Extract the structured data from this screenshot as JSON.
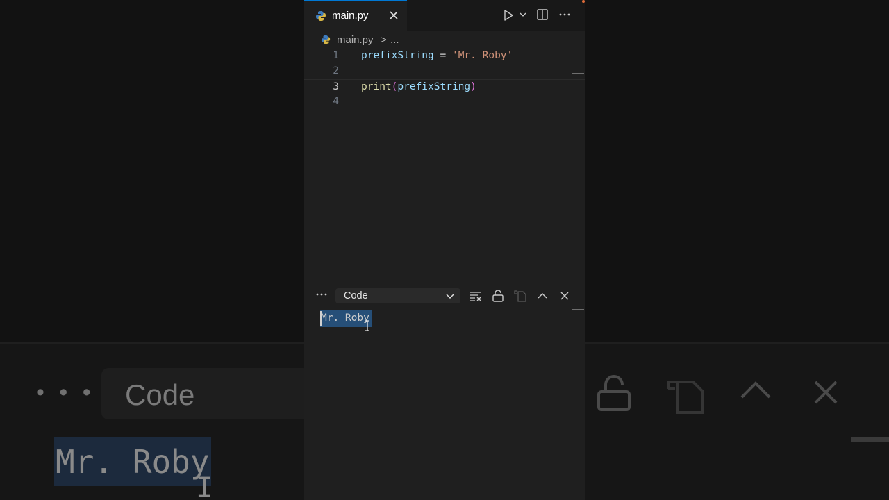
{
  "editor": {
    "tab": {
      "label": "main.py",
      "icon": "python-file-icon"
    },
    "toolbar": {
      "run": "play-icon",
      "split": "split-editor-icon",
      "more": "ellipsis-icon"
    },
    "breadcrumb": {
      "file": "main.py",
      "separator": ">",
      "more": "..."
    },
    "lines": [
      {
        "number": "1",
        "tokens": [
          {
            "t": "prefixString",
            "c": "var"
          },
          {
            "t": " = ",
            "c": "op"
          },
          {
            "t": "'Mr. Roby'",
            "c": "str"
          }
        ]
      },
      {
        "number": "2",
        "tokens": []
      },
      {
        "number": "3",
        "tokens": [
          {
            "t": "print",
            "c": "fn"
          },
          {
            "t": "(",
            "c": "paren"
          },
          {
            "t": "prefixString",
            "c": "var"
          },
          {
            "t": ")",
            "c": "paren"
          }
        ]
      },
      {
        "number": "4",
        "tokens": []
      }
    ],
    "active_line": "3"
  },
  "panel": {
    "selector_value": "Code",
    "output": "Mr. Roby"
  },
  "backdrop": {
    "selector_value": "Code",
    "output": "Mr. Roby",
    "dots": "• • •"
  }
}
